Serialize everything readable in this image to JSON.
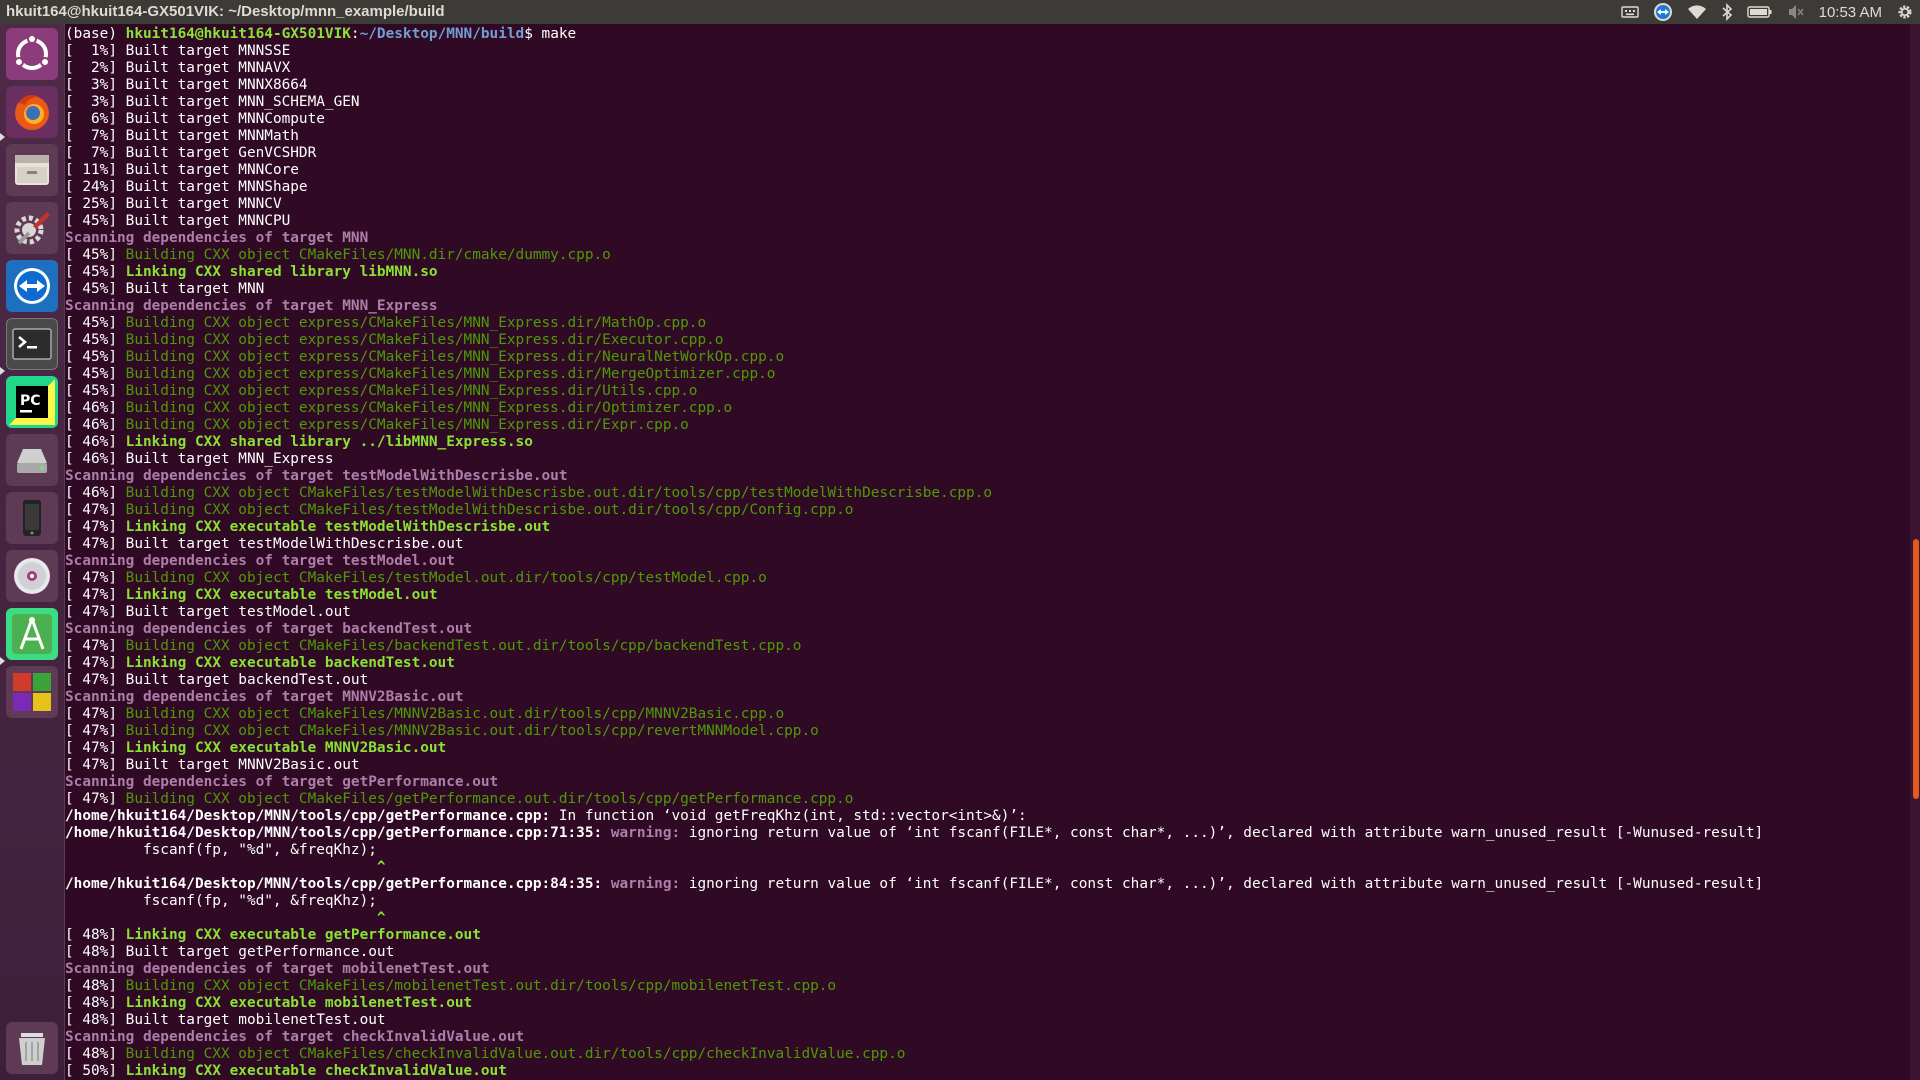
{
  "window": {
    "title": "hkuit164@hkuit164-GX501VIK: ~/Desktop/mnn_example/build"
  },
  "panel": {
    "keyboard_icon": "keyboard-icon",
    "teamviewer_icon": "teamviewer-icon",
    "wifi_icon": "wifi-icon",
    "bluetooth_icon": "bluetooth-icon",
    "battery_icon": "battery-icon",
    "volume_icon": "volume-muted-icon",
    "time": "10:53 AM",
    "settings_icon": "gear-icon"
  },
  "launcher": {
    "items": [
      {
        "name": "ubuntu-dash-icon"
      },
      {
        "name": "firefox-icon"
      },
      {
        "name": "files-icon"
      },
      {
        "name": "system-settings-icon"
      },
      {
        "name": "teamviewer-icon"
      },
      {
        "name": "terminal-icon"
      },
      {
        "name": "pycharm-icon"
      },
      {
        "name": "disk-icon"
      },
      {
        "name": "phone-icon"
      },
      {
        "name": "dvd-icon"
      },
      {
        "name": "android-studio-icon"
      },
      {
        "name": "workspace-switcher-icon"
      },
      {
        "name": "trash-icon"
      }
    ]
  },
  "colors": {
    "background": "#300a24",
    "build": "#4e9a06",
    "link": "#8ae234",
    "scan": "#ad7fa8",
    "prompt_path": "#729fcf",
    "scroll_thumb": "#e05a1b"
  },
  "terminal": {
    "prompt": {
      "env": "(base) ",
      "user": "hkuit164@hkuit164-GX501VIK",
      "colon": ":",
      "path": "~/Desktop/MNN/build",
      "dollar": "$ ",
      "command": "make"
    },
    "lines": [
      {
        "p": "[  1%] ",
        "t": "Built target MNNSSE",
        "s": "plain"
      },
      {
        "p": "[  2%] ",
        "t": "Built target MNNAVX",
        "s": "plain"
      },
      {
        "p": "[  3%] ",
        "t": "Built target MNNX8664",
        "s": "plain"
      },
      {
        "p": "[  3%] ",
        "t": "Built target MNN_SCHEMA_GEN",
        "s": "plain"
      },
      {
        "p": "[  6%] ",
        "t": "Built target MNNCompute",
        "s": "plain"
      },
      {
        "p": "[  7%] ",
        "t": "Built target MNNMath",
        "s": "plain"
      },
      {
        "p": "[  7%] ",
        "t": "Built target GenVCSHDR",
        "s": "plain"
      },
      {
        "p": "[ 11%] ",
        "t": "Built target MNNCore",
        "s": "plain"
      },
      {
        "p": "[ 24%] ",
        "t": "Built target MNNShape",
        "s": "plain"
      },
      {
        "p": "[ 25%] ",
        "t": "Built target MNNCV",
        "s": "plain"
      },
      {
        "p": "[ 45%] ",
        "t": "Built target MNNCPU",
        "s": "plain"
      },
      {
        "p": "",
        "t": "Scanning dependencies of target MNN",
        "s": "scan"
      },
      {
        "p": "[ 45%] ",
        "t": "Building CXX object CMakeFiles/MNN.dir/cmake/dummy.cpp.o",
        "s": "build"
      },
      {
        "p": "[ 45%] ",
        "t": "Linking CXX shared library libMNN.so",
        "s": "link"
      },
      {
        "p": "[ 45%] ",
        "t": "Built target MNN",
        "s": "plain"
      },
      {
        "p": "",
        "t": "Scanning dependencies of target MNN_Express",
        "s": "scan"
      },
      {
        "p": "[ 45%] ",
        "t": "Building CXX object express/CMakeFiles/MNN_Express.dir/MathOp.cpp.o",
        "s": "build"
      },
      {
        "p": "[ 45%] ",
        "t": "Building CXX object express/CMakeFiles/MNN_Express.dir/Executor.cpp.o",
        "s": "build"
      },
      {
        "p": "[ 45%] ",
        "t": "Building CXX object express/CMakeFiles/MNN_Express.dir/NeuralNetWorkOp.cpp.o",
        "s": "build"
      },
      {
        "p": "[ 45%] ",
        "t": "Building CXX object express/CMakeFiles/MNN_Express.dir/MergeOptimizer.cpp.o",
        "s": "build"
      },
      {
        "p": "[ 45%] ",
        "t": "Building CXX object express/CMakeFiles/MNN_Express.dir/Utils.cpp.o",
        "s": "build"
      },
      {
        "p": "[ 46%] ",
        "t": "Building CXX object express/CMakeFiles/MNN_Express.dir/Optimizer.cpp.o",
        "s": "build"
      },
      {
        "p": "[ 46%] ",
        "t": "Building CXX object express/CMakeFiles/MNN_Express.dir/Expr.cpp.o",
        "s": "build"
      },
      {
        "p": "[ 46%] ",
        "t": "Linking CXX shared library ../libMNN_Express.so",
        "s": "link"
      },
      {
        "p": "[ 46%] ",
        "t": "Built target MNN_Express",
        "s": "plain"
      },
      {
        "p": "",
        "t": "Scanning dependencies of target testModelWithDescrisbe.out",
        "s": "scan"
      },
      {
        "p": "[ 46%] ",
        "t": "Building CXX object CMakeFiles/testModelWithDescrisbe.out.dir/tools/cpp/testModelWithDescrisbe.cpp.o",
        "s": "build"
      },
      {
        "p": "[ 47%] ",
        "t": "Building CXX object CMakeFiles/testModelWithDescrisbe.out.dir/tools/cpp/Config.cpp.o",
        "s": "build"
      },
      {
        "p": "[ 47%] ",
        "t": "Linking CXX executable testModelWithDescrisbe.out",
        "s": "link"
      },
      {
        "p": "[ 47%] ",
        "t": "Built target testModelWithDescrisbe.out",
        "s": "plain"
      },
      {
        "p": "",
        "t": "Scanning dependencies of target testModel.out",
        "s": "scan"
      },
      {
        "p": "[ 47%] ",
        "t": "Building CXX object CMakeFiles/testModel.out.dir/tools/cpp/testModel.cpp.o",
        "s": "build"
      },
      {
        "p": "[ 47%] ",
        "t": "Linking CXX executable testModel.out",
        "s": "link"
      },
      {
        "p": "[ 47%] ",
        "t": "Built target testModel.out",
        "s": "plain"
      },
      {
        "p": "",
        "t": "Scanning dependencies of target backendTest.out",
        "s": "scan"
      },
      {
        "p": "[ 47%] ",
        "t": "Building CXX object CMakeFiles/backendTest.out.dir/tools/cpp/backendTest.cpp.o",
        "s": "build"
      },
      {
        "p": "[ 47%] ",
        "t": "Linking CXX executable backendTest.out",
        "s": "link"
      },
      {
        "p": "[ 47%] ",
        "t": "Built target backendTest.out",
        "s": "plain"
      },
      {
        "p": "",
        "t": "Scanning dependencies of target MNNV2Basic.out",
        "s": "scan"
      },
      {
        "p": "[ 47%] ",
        "t": "Building CXX object CMakeFiles/MNNV2Basic.out.dir/tools/cpp/MNNV2Basic.cpp.o",
        "s": "build"
      },
      {
        "p": "[ 47%] ",
        "t": "Building CXX object CMakeFiles/MNNV2Basic.out.dir/tools/cpp/revertMNNModel.cpp.o",
        "s": "build"
      },
      {
        "p": "[ 47%] ",
        "t": "Linking CXX executable MNNV2Basic.out",
        "s": "link"
      },
      {
        "p": "[ 47%] ",
        "t": "Built target MNNV2Basic.out",
        "s": "plain"
      },
      {
        "p": "",
        "t": "Scanning dependencies of target getPerformance.out",
        "s": "scan"
      },
      {
        "p": "[ 47%] ",
        "t": "Building CXX object CMakeFiles/getPerformance.out.dir/tools/cpp/getPerformance.cpp.o",
        "s": "build"
      },
      {
        "p": "",
        "t": "/home/hkuit164/Desktop/MNN/tools/cpp/getPerformance.cpp:",
        "s": "bold",
        "r": " In function ‘void getFreqKhz(int, std::vector<int>&)’:"
      },
      {
        "p": "",
        "t": "/home/hkuit164/Desktop/MNN/tools/cpp/getPerformance.cpp:71:35:",
        "s": "warnline",
        "w": " warning:",
        "r": " ignoring return value of ‘int fscanf(FILE*, const char*, ...)’, declared with attribute warn_unused_result [-Wunused-result]"
      },
      {
        "p": "",
        "t": "         fscanf(fp, \"%d\", &freqKhz);",
        "s": "plain"
      },
      {
        "p": "",
        "t": "                                    ^",
        "s": "caret"
      },
      {
        "p": "",
        "t": "/home/hkuit164/Desktop/MNN/tools/cpp/getPerformance.cpp:84:35:",
        "s": "warnline",
        "w": " warning:",
        "r": " ignoring return value of ‘int fscanf(FILE*, const char*, ...)’, declared with attribute warn_unused_result [-Wunused-result]"
      },
      {
        "p": "",
        "t": "         fscanf(fp, \"%d\", &freqKhz);",
        "s": "plain"
      },
      {
        "p": "",
        "t": "                                    ^",
        "s": "caret"
      },
      {
        "p": "[ 48%] ",
        "t": "Linking CXX executable getPerformance.out",
        "s": "link"
      },
      {
        "p": "[ 48%] ",
        "t": "Built target getPerformance.out",
        "s": "plain"
      },
      {
        "p": "",
        "t": "Scanning dependencies of target mobilenetTest.out",
        "s": "scan"
      },
      {
        "p": "[ 48%] ",
        "t": "Building CXX object CMakeFiles/mobilenetTest.out.dir/tools/cpp/mobilenetTest.cpp.o",
        "s": "build"
      },
      {
        "p": "[ 48%] ",
        "t": "Linking CXX executable mobilenetTest.out",
        "s": "link"
      },
      {
        "p": "[ 48%] ",
        "t": "Built target mobilenetTest.out",
        "s": "plain"
      },
      {
        "p": "",
        "t": "Scanning dependencies of target checkInvalidValue.out",
        "s": "scan"
      },
      {
        "p": "[ 48%] ",
        "t": "Building CXX object CMakeFiles/checkInvalidValue.out.dir/tools/cpp/checkInvalidValue.cpp.o",
        "s": "build"
      },
      {
        "p": "[ 50%] ",
        "t": "Linking CXX executable checkInvalidValue.out",
        "s": "link"
      }
    ]
  }
}
